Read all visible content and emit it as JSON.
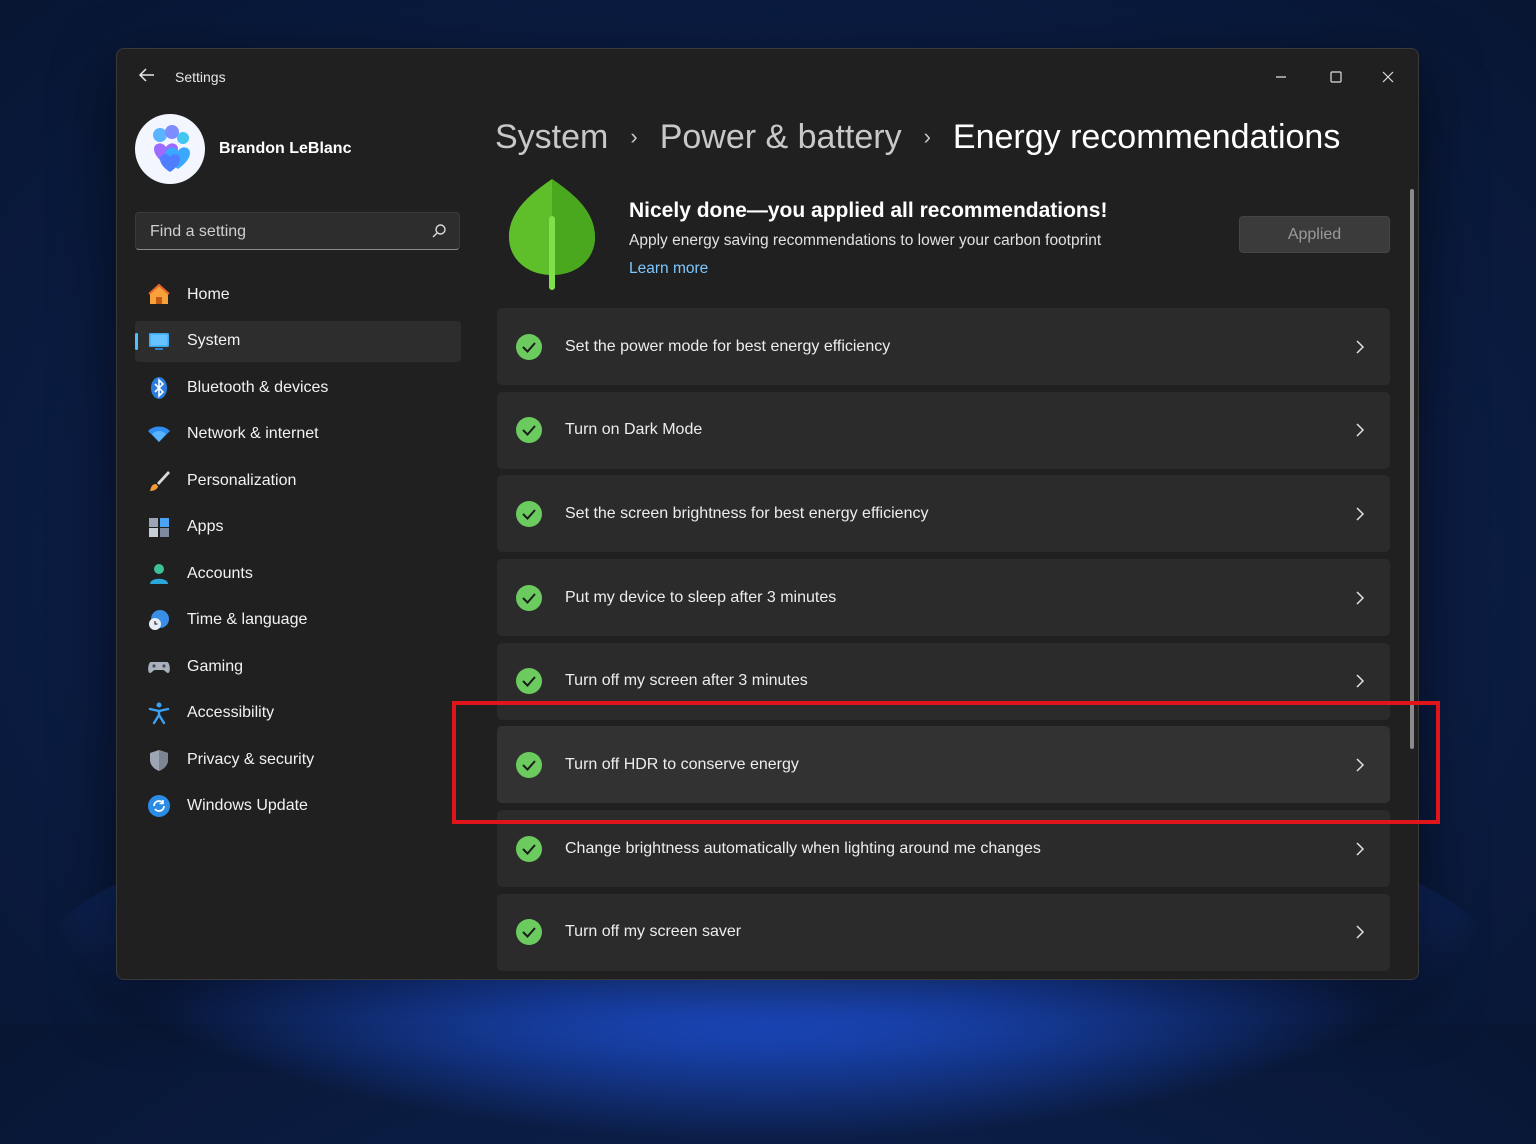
{
  "window": {
    "title": "Settings",
    "controls": {
      "minimize": "minimize",
      "maximize": "maximize",
      "close": "close"
    }
  },
  "profile": {
    "name": "Brandon LeBlanc"
  },
  "search": {
    "placeholder": "Find a setting",
    "value": ""
  },
  "sidebar": {
    "items": [
      {
        "label": "Home",
        "icon": "home-icon",
        "active": false
      },
      {
        "label": "System",
        "icon": "system-icon",
        "active": true
      },
      {
        "label": "Bluetooth & devices",
        "icon": "bluetooth-icon",
        "active": false
      },
      {
        "label": "Network & internet",
        "icon": "wifi-icon",
        "active": false
      },
      {
        "label": "Personalization",
        "icon": "brush-icon",
        "active": false
      },
      {
        "label": "Apps",
        "icon": "apps-icon",
        "active": false
      },
      {
        "label": "Accounts",
        "icon": "person-icon",
        "active": false
      },
      {
        "label": "Time & language",
        "icon": "clock-globe-icon",
        "active": false
      },
      {
        "label": "Gaming",
        "icon": "controller-icon",
        "active": false
      },
      {
        "label": "Accessibility",
        "icon": "accessibility-icon",
        "active": false
      },
      {
        "label": "Privacy & security",
        "icon": "shield-icon",
        "active": false
      },
      {
        "label": "Windows Update",
        "icon": "update-icon",
        "active": false
      }
    ]
  },
  "breadcrumb": {
    "items": [
      "System",
      "Power & battery",
      "Energy recommendations"
    ],
    "separator": "›"
  },
  "hero": {
    "title": "Nicely done—you applied all recommendations!",
    "subtitle": "Apply energy saving recommendations to lower your carbon footprint",
    "link": "Learn more",
    "button": "Applied"
  },
  "recommendations": [
    {
      "label": "Set the power mode for best energy efficiency",
      "status": "applied"
    },
    {
      "label": "Turn on Dark Mode",
      "status": "applied"
    },
    {
      "label": "Set the screen brightness for best energy efficiency",
      "status": "applied"
    },
    {
      "label": "Put my device to sleep after 3 minutes",
      "status": "applied"
    },
    {
      "label": "Turn off my screen after 3 minutes",
      "status": "applied"
    },
    {
      "label": "Turn off HDR to conserve energy",
      "status": "applied",
      "highlighted": true
    },
    {
      "label": "Change brightness automatically when lighting around me changes",
      "status": "applied"
    },
    {
      "label": "Turn off my screen saver",
      "status": "applied"
    }
  ],
  "colors": {
    "accent": "#4cc2ff",
    "check": "#6ccb5f",
    "highlight": "#e0141b",
    "window_bg": "#202020",
    "card_bg": "#2b2b2b"
  }
}
